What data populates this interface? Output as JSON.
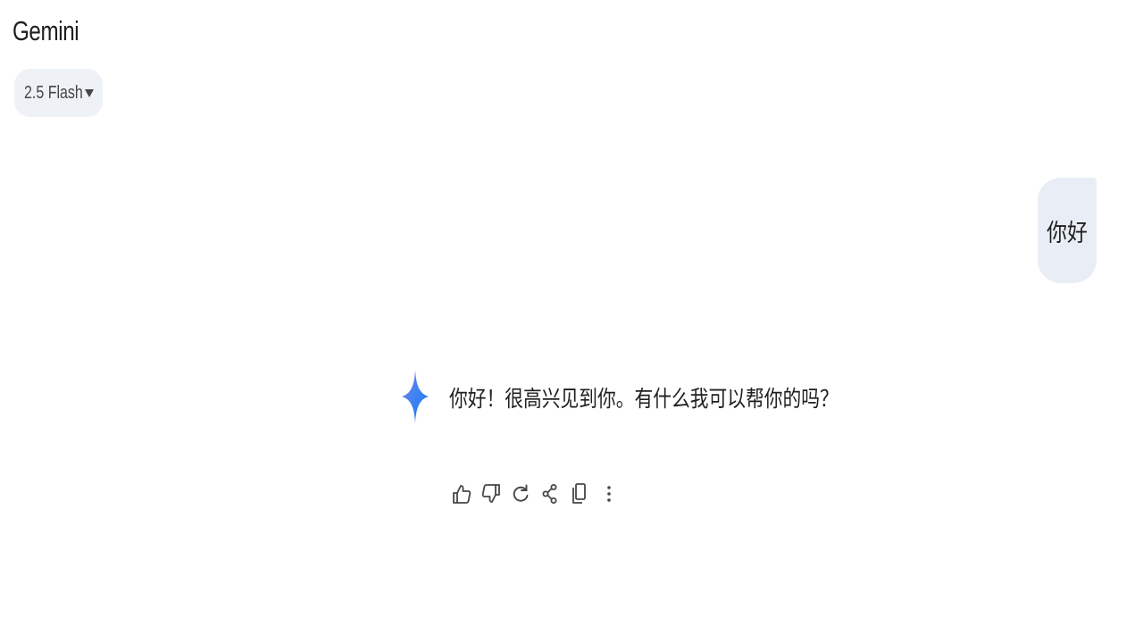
{
  "header": {
    "app_title": "Gemini",
    "model_label": "2.5 Flash"
  },
  "conversation": {
    "user_message": "你好",
    "assistant_message": "你好！很高兴见到你。有什么我可以帮你的吗？"
  },
  "actions": [
    {
      "icon": "thumbs-up-icon"
    },
    {
      "icon": "thumbs-down-icon"
    },
    {
      "icon": "regenerate-icon"
    },
    {
      "icon": "share-icon"
    },
    {
      "icon": "copy-icon"
    },
    {
      "icon": "more-vert-icon"
    }
  ],
  "colors": {
    "spark_start": "#4285f4",
    "spark_end": "#9b72cb",
    "bubble_bg": "#e9eef6",
    "chip_bg": "#eef1f5"
  }
}
